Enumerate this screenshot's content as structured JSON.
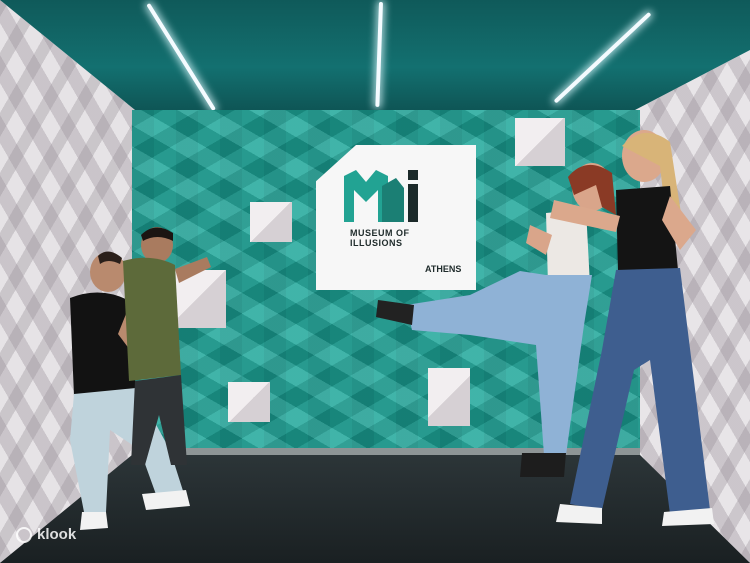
{
  "scene": {
    "logo": {
      "line1": "MUSEUM OF",
      "line2": "ILLUSIONS",
      "city": "ATHENS"
    },
    "watermark": "klook",
    "colors": {
      "ceiling": "#137070",
      "back_wall_teal": "#20a89a",
      "side_wall": "#e6e3e6",
      "floor": "#1f2629"
    }
  }
}
